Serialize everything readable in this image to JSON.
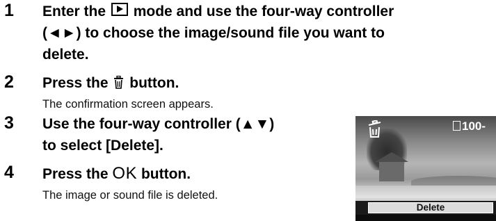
{
  "steps": [
    {
      "number": "1",
      "title_part1": "Enter the",
      "icon": "playback-icon",
      "title_part2": "mode and use the four-way controller",
      "title_line2": "(◄►) to choose the image/sound file you want to",
      "title_line3": "delete."
    },
    {
      "number": "2",
      "title_part1": "Press the",
      "icon": "trash-icon",
      "title_part2": "button.",
      "description": "The confirmation screen appears."
    },
    {
      "number": "3",
      "title_line1": "Use the four-way controller (▲▼)",
      "title_line2": "to select [Delete]."
    },
    {
      "number": "4",
      "title_part1": "Press the",
      "ok_label": "OK",
      "title_part2": "button.",
      "description": "The image or sound file is deleted."
    }
  ],
  "preview": {
    "file_number": "100-",
    "menu_option": "Delete",
    "overlay_icon": "trash-icon",
    "file_icon": "sd-card-icon"
  }
}
